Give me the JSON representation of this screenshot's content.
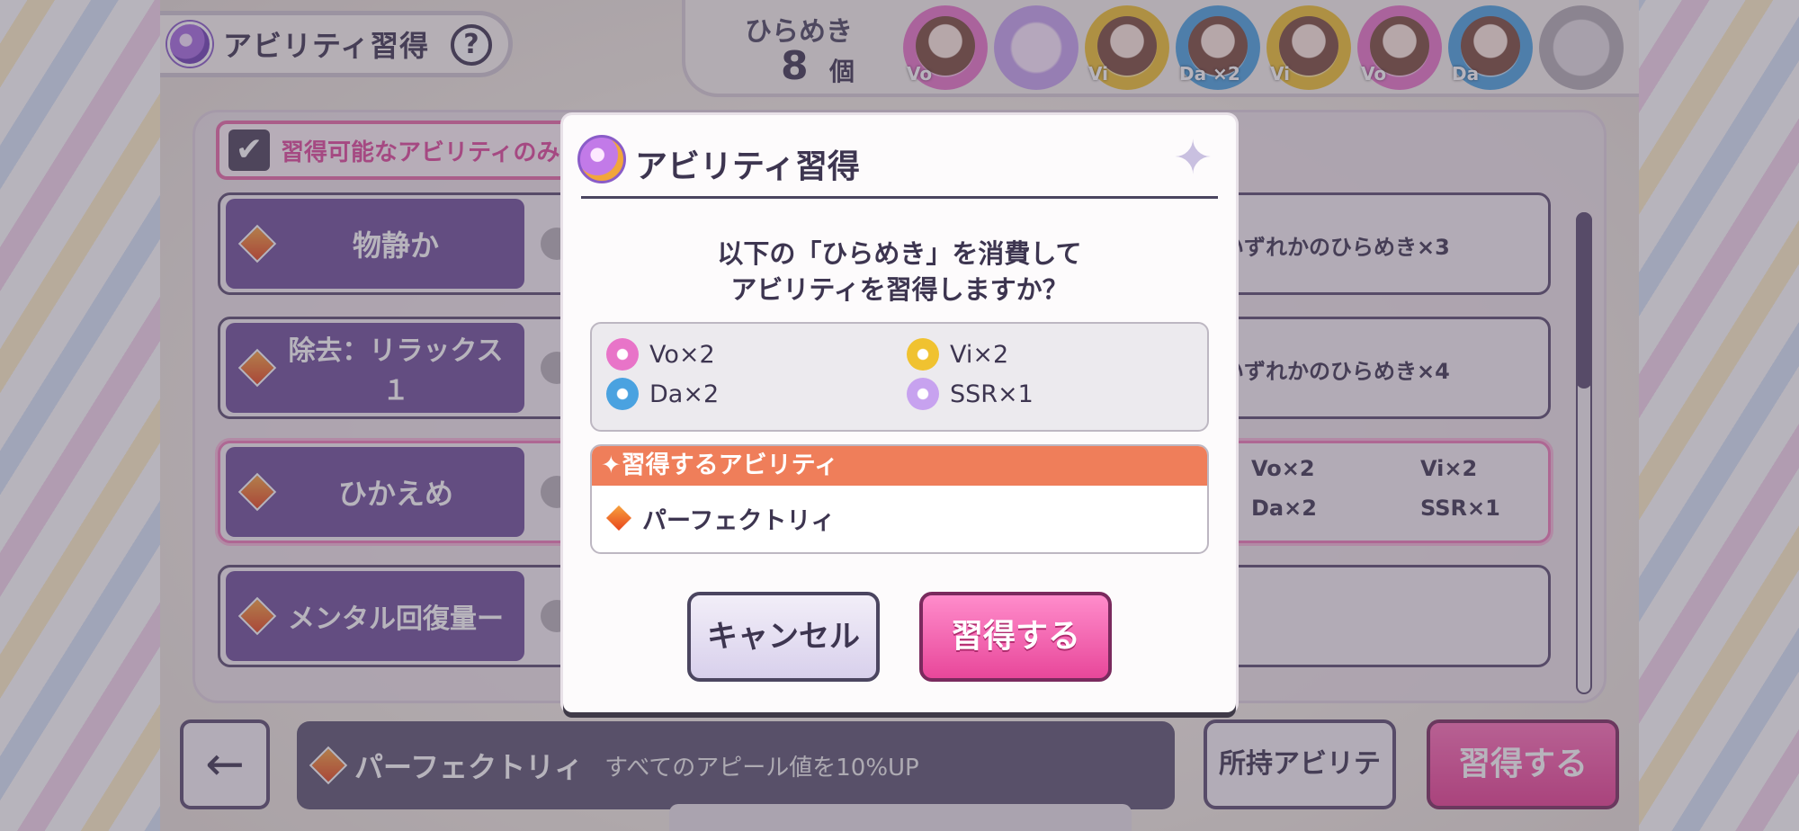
{
  "header": {
    "title": "アビリティ習得",
    "help": "?",
    "hirameki_label": "ひらめき",
    "hirameki_count": "8",
    "hirameki_unit": "個",
    "chips": [
      {
        "type": "Vo",
        "label": "Vo",
        "color": "#e874c8",
        "face": true
      },
      {
        "type": "SSR",
        "label": "",
        "color": "#c7a2ef",
        "face": false
      },
      {
        "type": "Vi",
        "label": "Vi",
        "color": "#f0c230",
        "face": true
      },
      {
        "type": "Da",
        "label": "Da ×2",
        "color": "#4aa2e0",
        "face": true
      },
      {
        "type": "Vi",
        "label": "Vi",
        "color": "#f0c230",
        "face": true
      },
      {
        "type": "Vo",
        "label": "Vo",
        "color": "#e874c8",
        "face": true
      },
      {
        "type": "Da",
        "label": "Da",
        "color": "#4aa2e0",
        "face": true
      },
      {
        "type": "empty",
        "label": "",
        "color": "#b3acb3",
        "face": false
      }
    ]
  },
  "filter": {
    "checked": true,
    "label": "習得可能なアビリティのみ"
  },
  "abilities": [
    {
      "name": "物静か",
      "cost": "いずれかのひらめき×3"
    },
    {
      "name": "除去：リラックス１",
      "cost": "いずれかのひらめき×4"
    },
    {
      "name": "ひかえめ",
      "cost_items": [
        "Vo×2",
        "Vi×2",
        "Da×2",
        "SSR×1"
      ]
    },
    {
      "name": "メンタル回復量ー",
      "cost": ""
    }
  ],
  "footer": {
    "back": "←",
    "selected_name": "パーフェクトリィ",
    "selected_desc": "すべてのアピール値を10%UP",
    "owned_button": "所持アビリティ",
    "learn_button": "習得する"
  },
  "modal": {
    "title": "アビリティ習得",
    "question_line1": "以下の「ひらめき」を消費して",
    "question_line2": "アビリティを習得しますか？",
    "costs": [
      {
        "label": "Vo×2",
        "icon": "vo-flower-icon",
        "color": "#e874c8"
      },
      {
        "label": "Vi×2",
        "icon": "vi-flower-icon",
        "color": "#f0c230"
      },
      {
        "label": "Da×2",
        "icon": "da-flower-icon",
        "color": "#4aa2e0"
      },
      {
        "label": "SSR×1",
        "icon": "ssr-flower-icon",
        "color": "#c7a2ef"
      }
    ],
    "learn_header": "✦習得するアビリティ",
    "learn_ability": "パーフェクトリィ",
    "cancel": "キャンセル",
    "confirm": "習得する"
  }
}
